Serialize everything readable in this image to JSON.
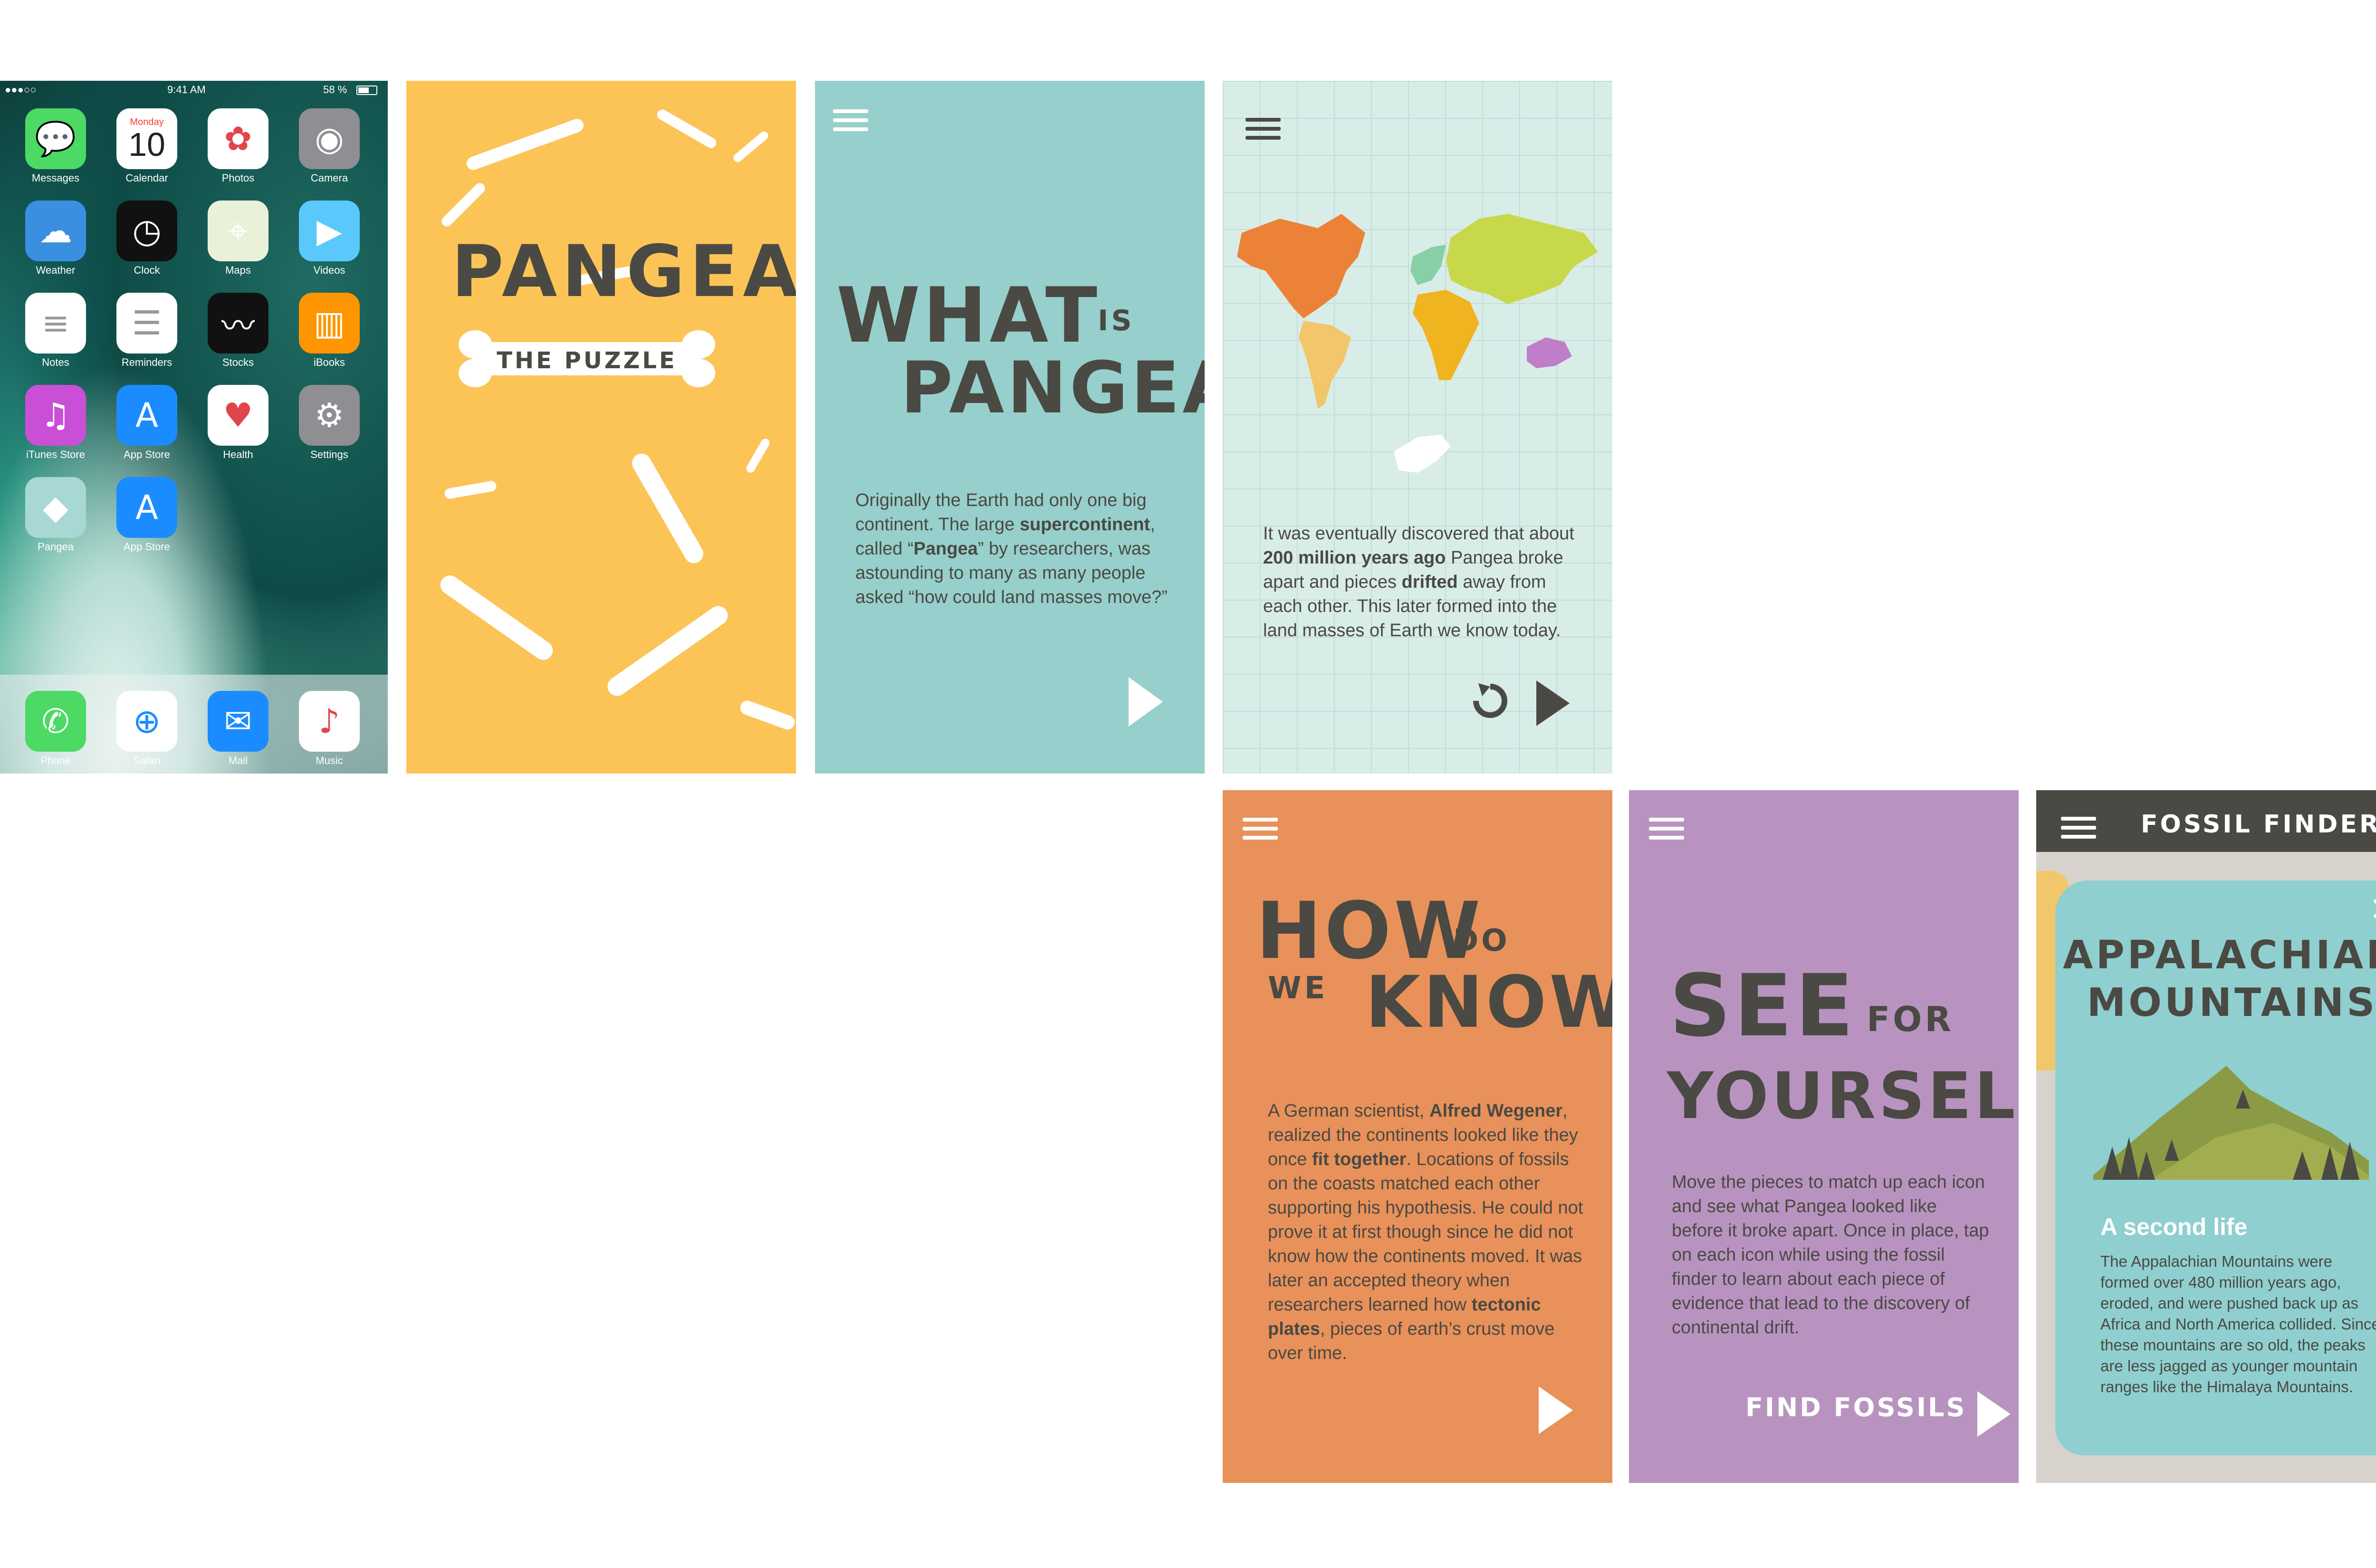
{
  "home": {
    "status": {
      "carrier": "●●●○○",
      "time": "9:41 AM",
      "battery": "58 %"
    },
    "apps": [
      {
        "label": "Messages",
        "icon": "messages-icon",
        "color": "#4cd964"
      },
      {
        "label": "Calendar",
        "icon": "calendar-icon",
        "color": "#ffffff",
        "day": "Monday",
        "date": "10"
      },
      {
        "label": "Photos",
        "icon": "photos-icon",
        "color": "#ffffff"
      },
      {
        "label": "Camera",
        "icon": "camera-icon",
        "color": "#8e8e93"
      },
      {
        "label": "Weather",
        "icon": "weather-icon",
        "color": "#3a8fe0"
      },
      {
        "label": "Clock",
        "icon": "clock-icon",
        "color": "#111111"
      },
      {
        "label": "Maps",
        "icon": "maps-icon",
        "color": "#e9f2d8"
      },
      {
        "label": "Videos",
        "icon": "videos-icon",
        "color": "#5ac8fa"
      },
      {
        "label": "Notes",
        "icon": "notes-icon",
        "color": "#ffffff"
      },
      {
        "label": "Reminders",
        "icon": "reminders-icon",
        "color": "#ffffff"
      },
      {
        "label": "Stocks",
        "icon": "stocks-icon",
        "color": "#111111"
      },
      {
        "label": "iBooks",
        "icon": "ibooks-icon",
        "color": "#ff9500"
      },
      {
        "label": "iTunes Store",
        "icon": "itunes-icon",
        "color": "#c94fd6"
      },
      {
        "label": "App Store",
        "icon": "appstore-icon",
        "color": "#1a8cff"
      },
      {
        "label": "Health",
        "icon": "health-icon",
        "color": "#ffffff"
      },
      {
        "label": "Settings",
        "icon": "settings-icon",
        "color": "#8e8e93"
      },
      {
        "label": "Pangea",
        "icon": "pangea-icon",
        "color": "#a8d8d4"
      },
      {
        "label": "App Store",
        "icon": "appstore-icon",
        "color": "#1a8cff"
      }
    ],
    "dock": [
      {
        "label": "Phone",
        "icon": "phone-icon",
        "color": "#4cd964"
      },
      {
        "label": "Safari",
        "icon": "safari-icon",
        "color": "#ffffff"
      },
      {
        "label": "Mail",
        "icon": "mail-icon",
        "color": "#1a8cff"
      },
      {
        "label": "Music",
        "icon": "music-icon",
        "color": "#ffffff"
      }
    ]
  },
  "title_screen": {
    "title": "PANGEA:",
    "subtitle": "THE PUZZLE"
  },
  "what_screen": {
    "heading_big1": "WHAT",
    "heading_small": "IS",
    "heading_big2": "PANGEA?",
    "body": [
      {
        "t": "Originally the Earth had only one big continent. The large "
      },
      {
        "t": "supercontinent",
        "b": true
      },
      {
        "t": ", called “"
      },
      {
        "t": "Pangea",
        "b": true
      },
      {
        "t": "” by researchers, was astounding to many as many people asked “how could land masses move?”"
      }
    ]
  },
  "map_screen": {
    "body": [
      {
        "t": "It was eventually discovered that about "
      },
      {
        "t": "200 million years ago",
        "b": true
      },
      {
        "t": " Pangea broke apart and pieces "
      },
      {
        "t": "drifted",
        "b": true
      },
      {
        "t": " away from each other. This later formed into the land masses of Earth we know today."
      }
    ],
    "colors": {
      "north_america": "#ec8237",
      "south_america": "#f2c66a",
      "europe": "#88cfa6",
      "asia": "#c7d94a",
      "africa": "#f0b421",
      "australia": "#c07ec9",
      "antarctica": "#ffffff"
    }
  },
  "how_screen": {
    "heading_big1": "HOW",
    "heading_small1": "DO",
    "heading_small2": "WE",
    "heading_big2": "KNOW?",
    "body": [
      {
        "t": "A German scientist, "
      },
      {
        "t": "Alfred Wegener",
        "b": true
      },
      {
        "t": ", realized the continents looked like they once "
      },
      {
        "t": "fit together",
        "b": true
      },
      {
        "t": ". Locations of fossils on the coasts matched each other supporting his hypothesis. He could not prove it at first though since he did not know how the continents moved. It was later an accepted theory when researchers learned how "
      },
      {
        "t": "tectonic plates",
        "b": true
      },
      {
        "t": ", pieces of earth’s crust move over time."
      }
    ]
  },
  "see_screen": {
    "heading_big1": "SEE",
    "heading_small": "FOR",
    "heading_big2": "YOURSELF",
    "body": [
      {
        "t": "Move the pieces to match up each icon and see what Pangea looked like before it broke apart. Once in place, tap on each icon while using the fossil finder to learn about each piece of evidence that lead to the discovery of continental drift."
      }
    ],
    "cta": "FIND FOSSILS"
  },
  "fossil_screen": {
    "header": "FOSSIL FINDER",
    "card_title1": "APPALACHIAN",
    "card_title2": "MOUNTAINS",
    "card_subtitle": "A second life",
    "card_body": "The Appalachian Mountains were formed over 480 million years ago, eroded, and were pushed back up as Africa and North America collided. Since these mountains are so old, the peaks are less jagged as younger mountain ranges like the Himalaya Mountains."
  }
}
